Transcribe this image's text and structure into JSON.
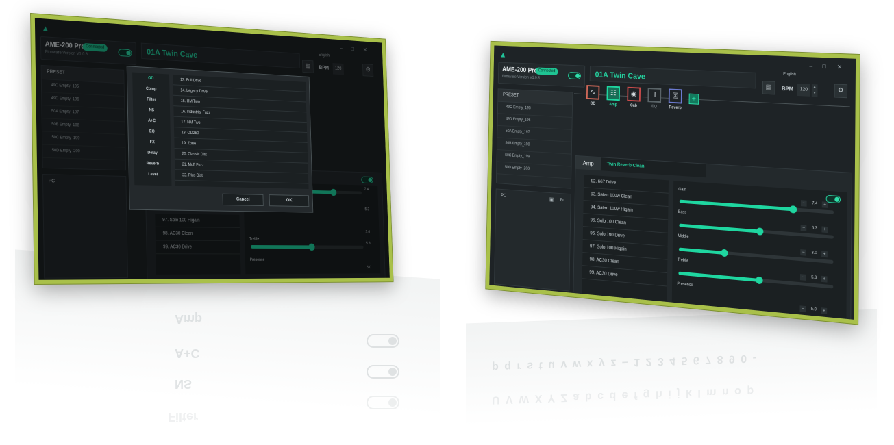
{
  "device": {
    "name": "AME-200 Pro",
    "status": "Connected",
    "firmware": "Firmware Version V1.0.8"
  },
  "preset": {
    "current": "01A  Twin Cave"
  },
  "language": "English",
  "window_controls": [
    "–",
    "□",
    "✕"
  ],
  "toolbar": {
    "bpm_label": "BPM",
    "bpm_value": "120",
    "save_icon": "save-icon",
    "settings_icon": "gear-icon"
  },
  "preset_list": {
    "title": "PRESET",
    "items": [
      "49C Empty_195",
      "49D Empty_196",
      "50A Empty_197",
      "50B Empty_198",
      "50C Empty_199",
      "50D Empty_200"
    ]
  },
  "pc_panel": {
    "label": "PC"
  },
  "chain": {
    "modules": [
      {
        "name": "OD",
        "icon": "wave-icon"
      },
      {
        "name": "Amp",
        "icon": "amp-icon"
      },
      {
        "name": "Cab",
        "icon": "cab-icon"
      },
      {
        "name": "EQ",
        "icon": "eq-icon"
      },
      {
        "name": "Reverb",
        "icon": "reverb-icon"
      }
    ],
    "add": "+"
  },
  "amp": {
    "tab": "Amp",
    "model": "Twin Reverb Clean",
    "models": [
      "92.  667 Drive",
      "93.  Satan 100w Clean",
      "94.  Satan 100w Higain",
      "95.  Solo 100 Clean",
      "96.  Solo 100 Drive",
      "97.  Solo 100 Higain",
      "98.  AC30 Clean",
      "99.  AC30 Drive"
    ],
    "models_left": [
      "97.  Solo 100 Higain",
      "98.  AC30 Clean",
      "99.  AC30 Drive"
    ],
    "params": [
      {
        "label": "Gain",
        "value": "7.4",
        "level": 0.74
      },
      {
        "label": "Bass",
        "value": "5.3",
        "level": 0.53
      },
      {
        "label": "Middle",
        "value": "3.0",
        "level": 0.3
      },
      {
        "label": "Treble",
        "value": "5.3",
        "level": 0.53
      },
      {
        "label": "Presence",
        "value": "5.0",
        "level": 0.5
      }
    ]
  },
  "dialog": {
    "categories": [
      "OD",
      "Comp",
      "Filter",
      "NS",
      "A+C",
      "EQ",
      "FX",
      "Delay",
      "Reverb",
      "Level"
    ],
    "effects": [
      "13. Full Drive",
      "14. Legacy Drive",
      "15. HM Two",
      "16. Industrial Fuzz",
      "17. HM Two",
      "18. OD250",
      "19. Zone",
      "20. Classic Dist",
      "21. Muff Fuzz",
      "22. Plus Dist"
    ],
    "cancel": "Cancel",
    "ok": "OK"
  },
  "reflections": {
    "left_words": [
      "Amp",
      "A+C",
      "NS",
      "Filter"
    ],
    "right_line1": "p q r s t u v w x y z – 1 2 3 4 5 6 7 8 9 0 -",
    "right_line2": "U V W X Y Z a b c d e f g h i j k l m n o p"
  },
  "colors": {
    "accent": "#1fd6a0",
    "frame": "#a9c04a",
    "bg": "#1e2326"
  }
}
